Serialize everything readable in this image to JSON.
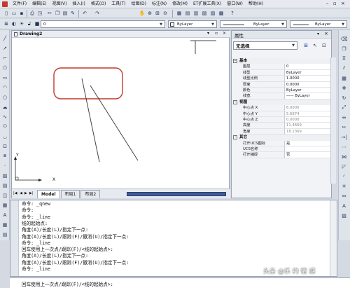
{
  "menu": [
    "文件(F)",
    "编辑(E)",
    "视图(V)",
    "插入(I)",
    "格式(O)",
    "工具(T)",
    "绘图(D)",
    "标注(N)",
    "修改(M)",
    "ET扩展工具(X)",
    "窗口(W)",
    "帮助(H)"
  ],
  "toolbar": {
    "layer_value": "0",
    "color_value": "ByLayer",
    "linetype_value": "ByLayer",
    "lineweight_value": "ByLayer"
  },
  "drawing": {
    "tab_title": "Drawing2",
    "axis_y": "Y",
    "axis_x": "X",
    "layout_tabs": [
      "Model",
      "布局1",
      "布局2"
    ]
  },
  "properties": {
    "title": "属性",
    "selector": "无选择",
    "categories": {
      "basic": "基本",
      "view": "视图",
      "other": "其它"
    },
    "basic_rows": [
      {
        "name": "图层",
        "value": "0"
      },
      {
        "name": "线型",
        "value": "ByLayer"
      },
      {
        "name": "线型比例",
        "value": "1.0000"
      },
      {
        "name": "厚度",
        "value": "0.0000"
      },
      {
        "name": "颜色",
        "value": "ByLayer"
      },
      {
        "name": "线宽",
        "value": "—— ByLayer"
      }
    ],
    "view_rows": [
      {
        "name": "中心点 X",
        "value": "6.0000"
      },
      {
        "name": "中心点 Y",
        "value": "5.6874"
      },
      {
        "name": "中心点 Z",
        "value": "0.0000"
      },
      {
        "name": "高度",
        "value": "11.4669"
      },
      {
        "name": "宽度",
        "value": "18.1369"
      }
    ],
    "other_rows": [
      {
        "name": "打开UCS图标",
        "value": "是"
      },
      {
        "name": "UCS名称",
        "value": ""
      },
      {
        "name": "打开捕捉",
        "value": "否"
      }
    ]
  },
  "command": {
    "lines": [
      "命令: _qnew",
      "命令:",
      "命令: _line",
      "线的起始点:",
      "角度(A)/长度(L)/指定下一点:",
      "角度(A)/长度(L)/跟踪(F)/撤消(U)/指定下一点:",
      "命令: _line",
      "回车使用上一次点/跟踪(F)/<线的起始点>:",
      "角度(A)/长度(L)/指定下一点:",
      "角度(A)/长度(L)/跟踪(F)/撤消(U)/指定下一点:",
      "命令: _line"
    ],
    "prompt": "回车使用上一次点/跟踪(F)/<线的起始点>:"
  },
  "watermark": "头条 @乐 约 情 感"
}
